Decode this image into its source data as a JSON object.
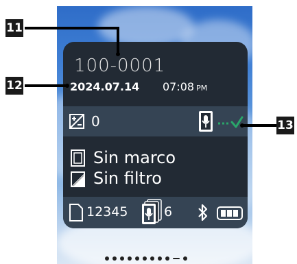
{
  "info_screen": {
    "file_number": "100-0001",
    "date": "2024.07.14",
    "time": "07:08",
    "ampm": "PM",
    "exposure_value": "0",
    "frame_label": "Sin marco",
    "filter_label": "Sin filtro",
    "shots_remaining": "12345",
    "stack_count": "6"
  },
  "callouts": {
    "c11": "11",
    "c12": "12",
    "c13": "13"
  },
  "colors": {
    "panel": "#222a34",
    "strip": "#354454",
    "status_ok": "#2aa66a",
    "callout_bg": "#1a1a1a"
  },
  "icons": {
    "exposure": "exposure-comp-icon",
    "voice_memo": "voice-memo-icon",
    "frame": "frame-icon",
    "filter": "filter-icon",
    "file": "file-icon",
    "stack": "voice-stack-icon",
    "bluetooth": "bluetooth-icon",
    "battery": "battery-icon"
  }
}
